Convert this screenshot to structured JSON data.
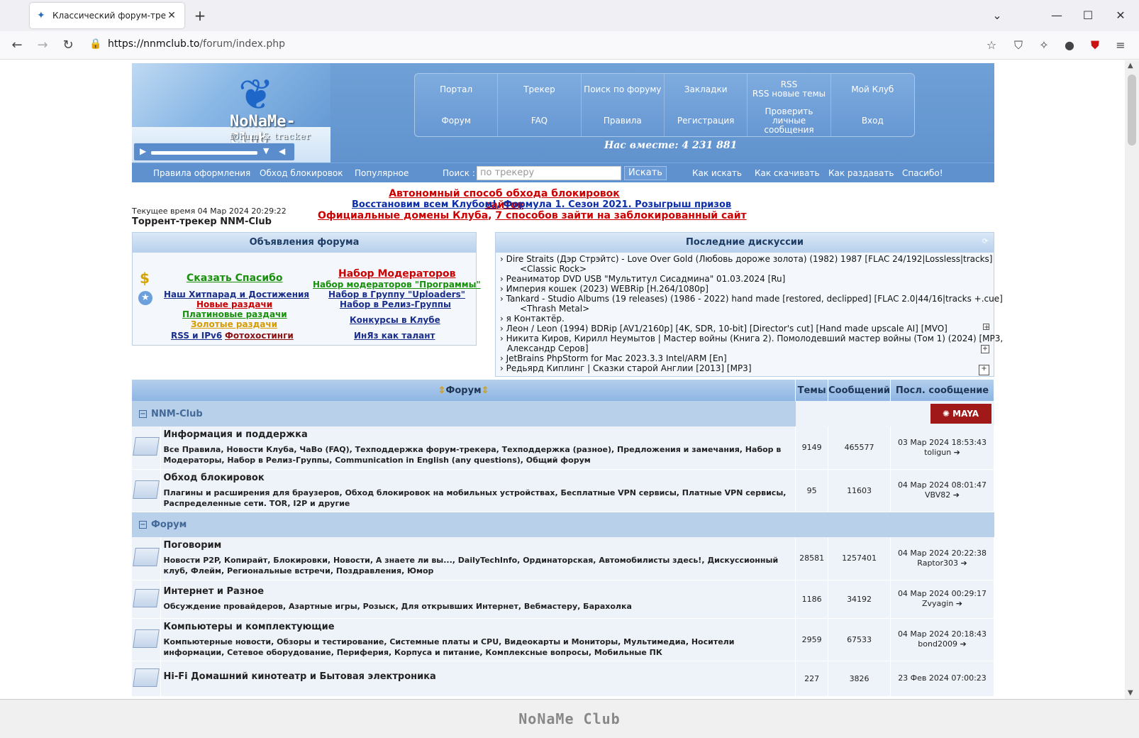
{
  "browser": {
    "tab_title": "Классический форум-трекер",
    "url_host": "https://nnmclub.to",
    "url_path": "/forum/index.php"
  },
  "header": {
    "logo_text": "NoNaMe-Club",
    "logo_sub": "forum & tracker",
    "menu": [
      "Портал",
      "Трекер",
      "Поиск по форуму",
      "Закладки",
      "RSS\nRSS новые темы",
      "Мой Клуб",
      "Форум",
      "FAQ",
      "Правила",
      "Регистрация",
      "Проверить личные сообщения",
      "Вход"
    ],
    "together": "Нас вместе: 4 231 881"
  },
  "subnav": {
    "items": [
      "Правила оформления",
      "Обход блокировок",
      "Популярное"
    ],
    "search_label": "Поиск :",
    "search_placeholder": "по трекеру",
    "search_button": "Искать",
    "right_items": [
      "Как искать",
      "Как скачивать",
      "Как раздавать",
      "Спасибо!"
    ]
  },
  "announce": {
    "current_time": "Текущее время 04 Мар 2024 20:29:22",
    "tracker_title": "Торрент-трекер NNM-Club",
    "line1": "Автономный способ обхода блокировок сайтов",
    "line2a": "Восстановим всем Клубом!",
    "line2b": "Формула 1. Сезон 2021. Розыгрыш призов",
    "line3a": "Официальные домены Клуба",
    "line3b": "7 способов зайти на заблокированный сайт"
  },
  "ads": {
    "title": "Объявления форума",
    "left": [
      "Сказать Спасибо",
      "Наш Хитпарад и Достижения",
      "Новые раздачи",
      "Платиновые раздачи",
      "Золотые раздачи",
      "RSS и IPv6",
      "Фотохостинги"
    ],
    "right": [
      "Набор Модераторов",
      "Набор модераторов \"Программы\"",
      "Набор в Группу \"Uploaders\"",
      "Набор в Релиз-Группы",
      "Конкурсы в Клубе",
      "ИнЯз как талант"
    ]
  },
  "discussions": {
    "title": "Последние дискуссии",
    "items": [
      "Dire Straits (Дэр Стрэйтс) - Love Over Gold (Любовь дороже золота) (1982) 1987 [FLAC 24/192|Lossless|tracks]",
      "<Classic Rock>",
      "Реаниматор DVD USB \"Мультитул Сисадмина\" 01.03.2024 [Ru]",
      "Империя кошек (2023) WEBRip [H.264/1080p]",
      "Tankard - Studio Albums (19 releases) (1986 - 2022) hand made [restored, declipped] [FLAC 2.0|44/16|tracks +.cue]",
      "<Thrash Metal>",
      "я Контактёр.",
      "Леон / Leon (1994) BDRip [AV1/2160p] [4K, SDR, 10-bit] [Director's cut] [Hand made upscale AI] [MVO]",
      "Никита Киров, Кирилл Неумытов | Мастер войны (Книга 2). Помолодевший мастер войны (Том 1) (2024) [MP3,",
      "Александр Серов]",
      "JetBrains PhpStorm for Mac 2023.3.3 Intel/ARM [En]",
      "Редьярд Киплинг | Сказки старой Англии [2013] [MP3]"
    ]
  },
  "forum": {
    "headers": [
      "Форум",
      "Темы",
      "Сообщений",
      "Посл. сообщение"
    ],
    "cat1": "NNM-Club",
    "cat2": "Форум",
    "rows": [
      {
        "name": "Информация и поддержка",
        "subs": "Все Правила, Новости Клуба, ЧаВо (FAQ), Техподдержка форум-трекера, Техподдержка (разное), Предложения и замечания, Набор в Модераторы, Набор в Релиз-Группы, Communication in English (any questions), Общий форум",
        "topics": "9149",
        "posts": "465577",
        "date": "03 Мар 2024 18:53:43",
        "user": "toligun"
      },
      {
        "name": "Обход блокировок",
        "subs": "Плагины и расширения для браузеров, Обход блокировок на мобильных устройствах, Бесплатные VPN сервисы, Платные VPN сервисы, Распределенные сети. TOR, I2P и другие",
        "topics": "95",
        "posts": "11603",
        "date": "04 Мар 2024 08:01:47",
        "user": "VBV82"
      },
      {
        "name": "Поговорим",
        "subs": "Новости P2P, Копирайт, Блокировки, Новости, А знаете ли вы..., DailyTechInfo, Ординаторская, Автомобилисты здесь!, Дискуссионный клуб, Флейм, Региональные встречи, Поздравления, Юмор",
        "topics": "28581",
        "posts": "1257401",
        "date": "04 Мар 2024 20:22:38",
        "user": "Raptor303"
      },
      {
        "name": "Интернет и Разное",
        "subs": "Обсуждение провайдеров, Азартные игры, Розыск, Для открывших Интернет, Вебмастеру, Барахолка",
        "topics": "1186",
        "posts": "34192",
        "date": "04 Мар 2024 00:29:17",
        "user": "Zvyagin"
      },
      {
        "name": "Компьютеры и комплектующие",
        "subs": "Компьютерные новости, Обзоры и тестирование, Системные платы и CPU, Видеокарты и Мониторы, Мультимедиа, Носители информации, Сетевое оборудование, Периферия, Корпуса и питание, Комплексные вопросы, Мобильные ПК",
        "topics": "2959",
        "posts": "67533",
        "date": "04 Мар 2024 20:18:43",
        "user": "bond2009"
      },
      {
        "name": "Hi-Fi Домашний кинотеатр и Бытовая электроника",
        "subs": "",
        "topics": "227",
        "posts": "3826",
        "date": "23 Фев 2024 07:00:23",
        "user": ""
      }
    ]
  },
  "footer_logo": "NoNaMe Club",
  "icons": [
    "back-icon",
    "forward-icon",
    "reload-icon",
    "lock-icon",
    "star-icon",
    "shield-icon",
    "extension-icon",
    "menu-icon"
  ]
}
